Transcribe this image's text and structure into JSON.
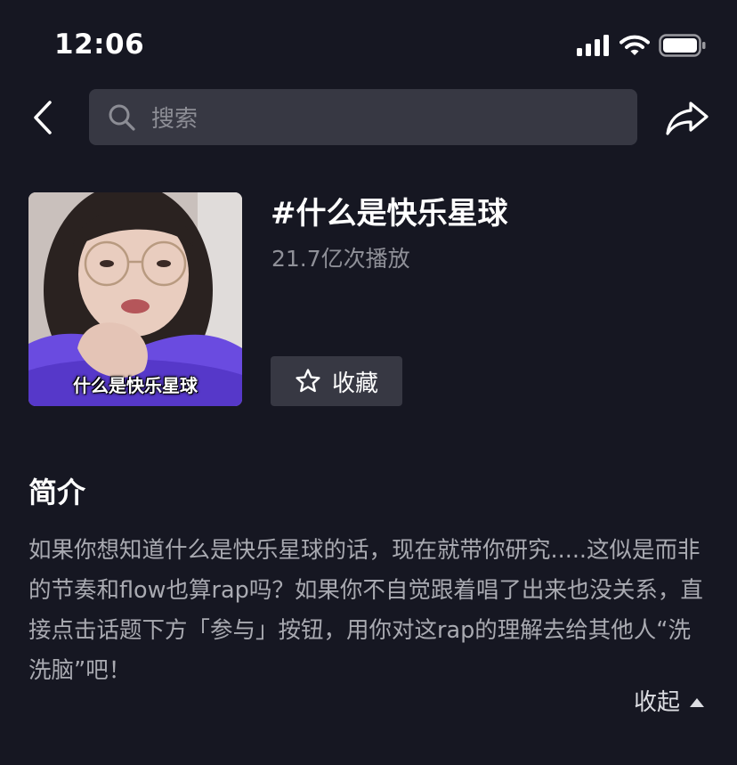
{
  "status_bar": {
    "time": "12:06",
    "icons": [
      "signal-icon",
      "wifi-icon",
      "battery-icon"
    ]
  },
  "nav": {
    "back_icon": "chevron-left-icon",
    "search_placeholder": "搜索",
    "share_icon": "share-arrow-icon"
  },
  "topic": {
    "title": "#什么是快乐星球",
    "play_count": "21.7亿次播放",
    "cover_caption": "什么是快乐星球",
    "collect_label": "收藏",
    "collect_icon": "star-outline-icon"
  },
  "intro": {
    "heading": "简介",
    "text": "如果你想知道什么是快乐星球的话，现在就带你研究.....这似是而非的节奏和flow也算rap吗？如果你不自觉跟着唱了出来也没关系，直接点击话题下方「参与」按钮，用你对这rap的理解去给其他人“洗洗脑”吧！",
    "collapse_label": "收起",
    "collapse_icon": "triangle-up-icon"
  },
  "colors": {
    "background": "#161722",
    "surface": "#373843",
    "secondary_text": "#8f9098",
    "body_text": "#a9aab1"
  }
}
